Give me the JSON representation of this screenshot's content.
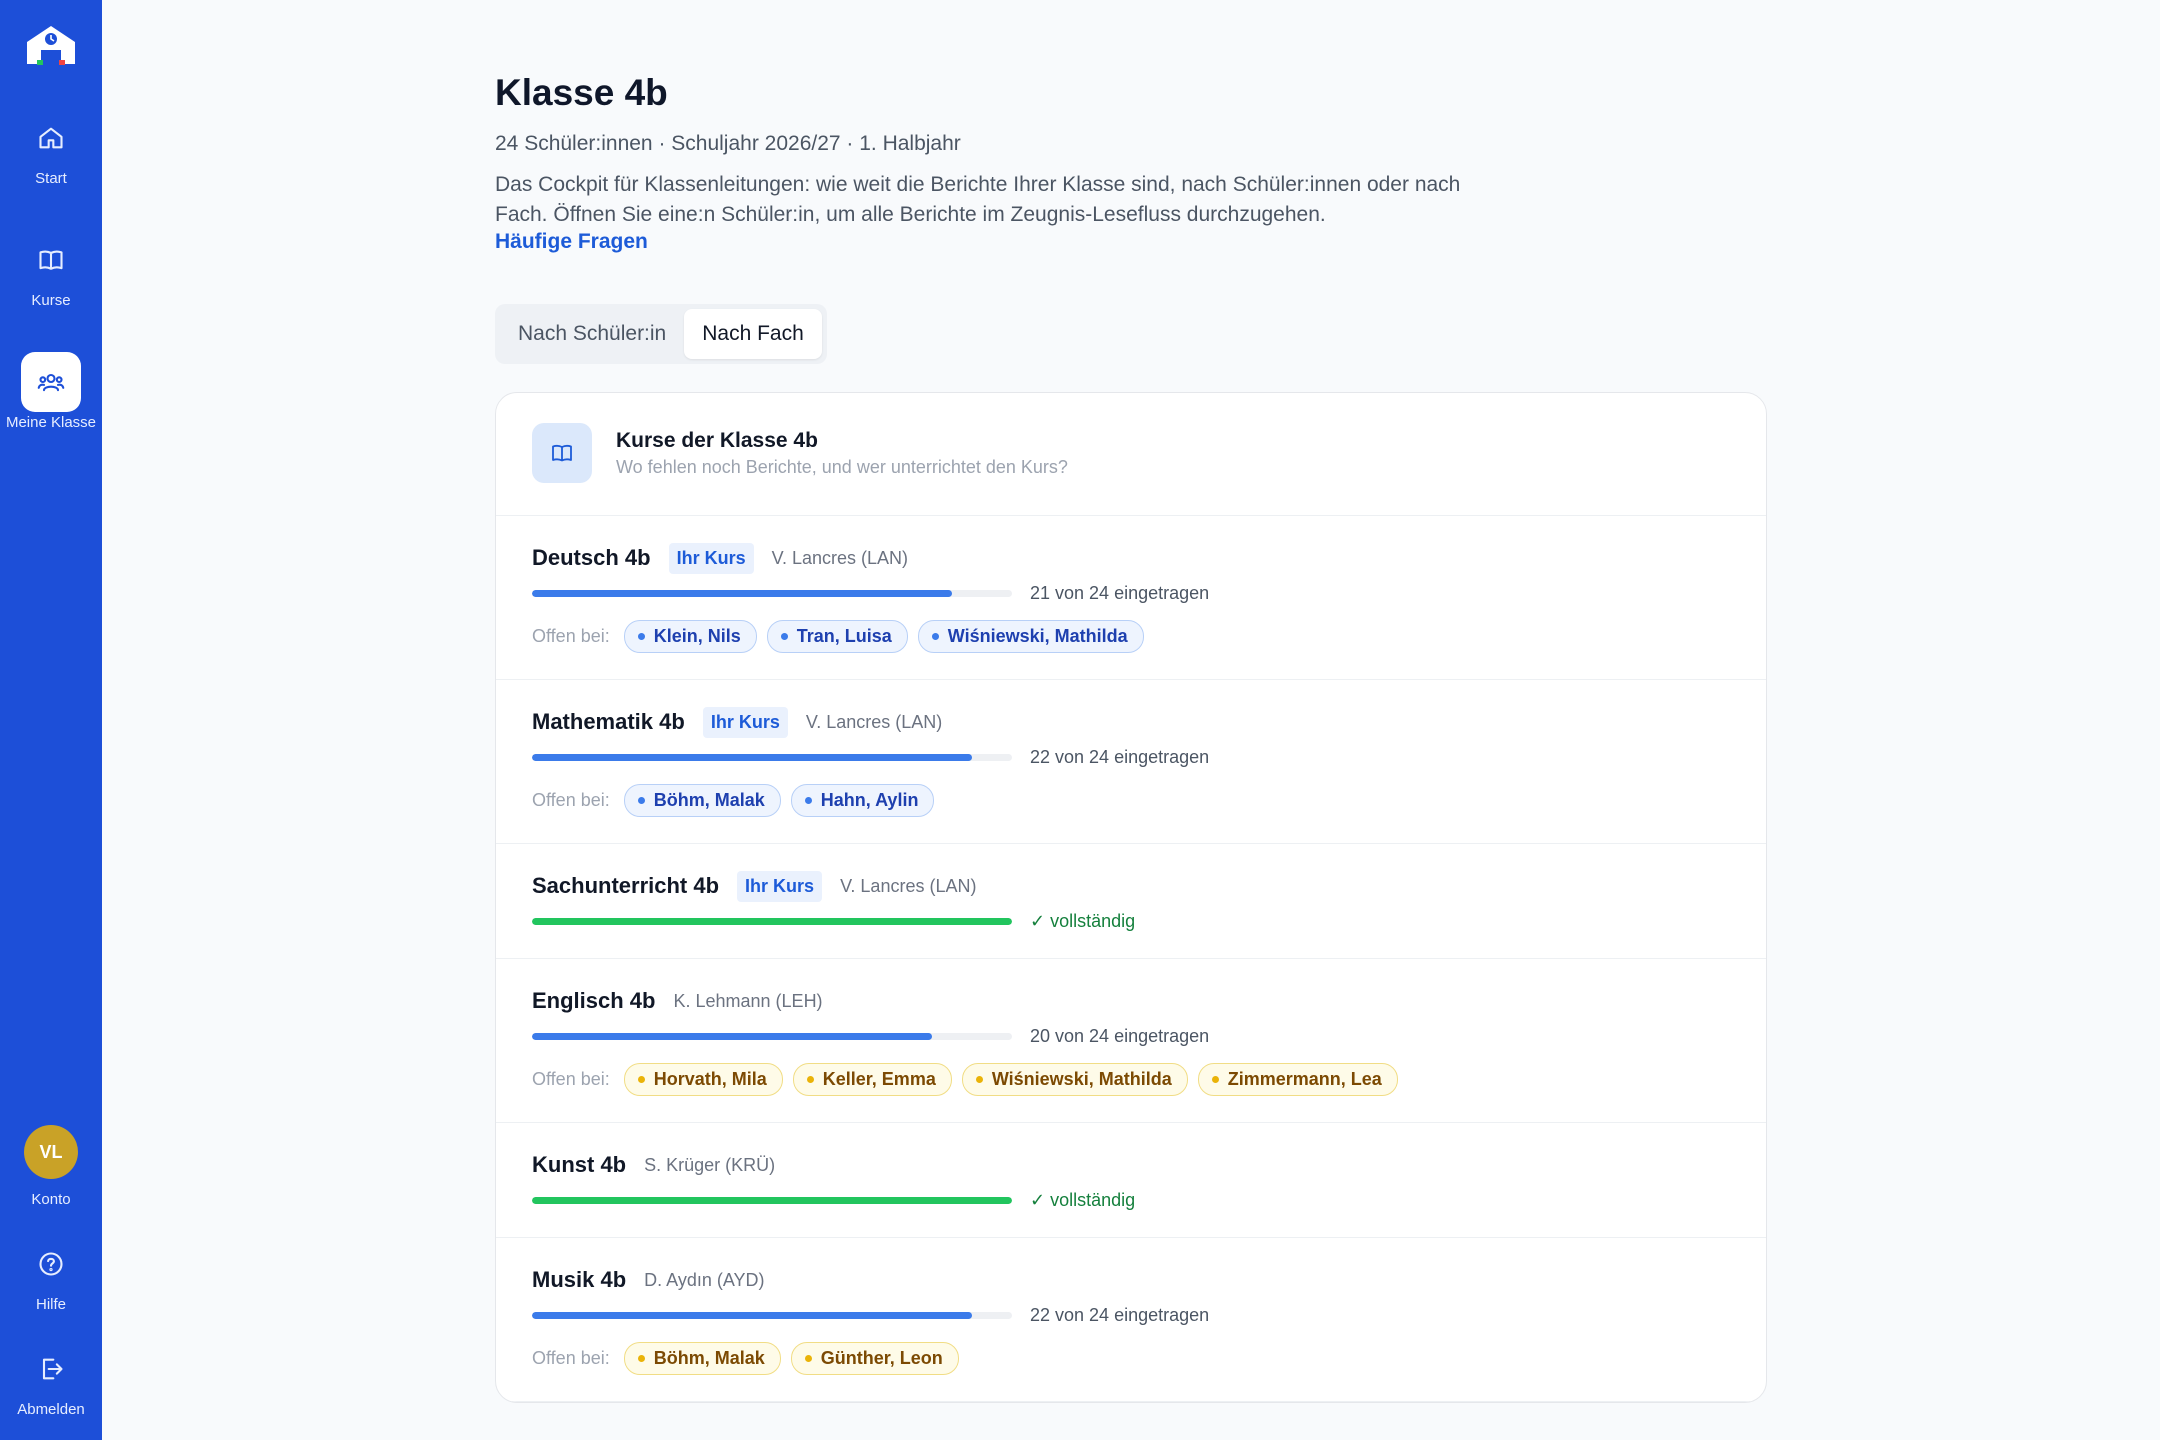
{
  "sidebar": {
    "nav": [
      {
        "label": "Start",
        "icon": "home-icon"
      },
      {
        "label": "Kurse",
        "icon": "book-icon"
      },
      {
        "label": "Meine Klasse",
        "icon": "users-icon"
      }
    ],
    "account": {
      "initials": "VL",
      "label": "Konto"
    },
    "help_label": "Hilfe",
    "logout_label": "Abmelden"
  },
  "header": {
    "title": "Klasse 4b",
    "subtitle": "24 Schüler:innen · Schuljahr 2026/27 · 1. Halbjahr",
    "intro": "Das Cockpit für Klassenleitungen: wie weit die Berichte Ihrer Klasse sind, nach Schüler:innen oder nach Fach. Öffnen Sie eine:n Schüler:in, um alle Berichte im Zeugnis-Lesefluss durchzugehen.",
    "faq_link": "Häufige Fragen"
  },
  "tabs": [
    {
      "label": "Nach Schüler:in",
      "active": false
    },
    {
      "label": "Nach Fach",
      "active": true
    }
  ],
  "card": {
    "title": "Kurse der Klasse 4b",
    "subtitle": "Wo fehlen noch Berichte, und wer unterrichtet den Kurs?"
  },
  "open_label": "Offen bei:",
  "own_badge": "Ihr Kurs",
  "complete_label": "vollständig",
  "courses": [
    {
      "name": "Deutsch 4b",
      "own": true,
      "teacher": "V. Lancres (LAN)",
      "progress": 0.875,
      "status": "21 von 24 eingetragen",
      "open": [
        "Klein, Nils",
        "Tran, Luisa",
        "Wiśniewski, Mathilda"
      ],
      "chip_color": "blue"
    },
    {
      "name": "Mathematik 4b",
      "own": true,
      "teacher": "V. Lancres (LAN)",
      "progress": 0.917,
      "status": "22 von 24 eingetragen",
      "open": [
        "Böhm, Malak",
        "Hahn, Aylin"
      ],
      "chip_color": "blue"
    },
    {
      "name": "Sachunterricht 4b",
      "own": true,
      "teacher": "V. Lancres (LAN)",
      "progress": 1.0,
      "status": "vollständig",
      "complete": true,
      "open": []
    },
    {
      "name": "Englisch 4b",
      "own": false,
      "teacher": "K. Lehmann (LEH)",
      "progress": 0.833,
      "status": "20 von 24 eingetragen",
      "open": [
        "Horvath, Mila",
        "Keller, Emma",
        "Wiśniewski, Mathilda",
        "Zimmermann, Lea"
      ],
      "chip_color": "yellow"
    },
    {
      "name": "Kunst 4b",
      "own": false,
      "teacher": "S. Krüger (KRÜ)",
      "progress": 1.0,
      "status": "vollständig",
      "complete": true,
      "open": []
    },
    {
      "name": "Musik 4b",
      "own": false,
      "teacher": "D. Aydın (AYD)",
      "progress": 0.917,
      "status": "22 von 24 eingetragen",
      "open": [
        "Böhm, Malak",
        "Günther, Leon"
      ],
      "chip_color": "yellow"
    }
  ],
  "colors": {
    "sidebar": "#1d4fd8",
    "accent": "#1d5bd8",
    "progress": "#3b7bea",
    "complete": "#22c55e",
    "avatar": "#c9a227"
  }
}
